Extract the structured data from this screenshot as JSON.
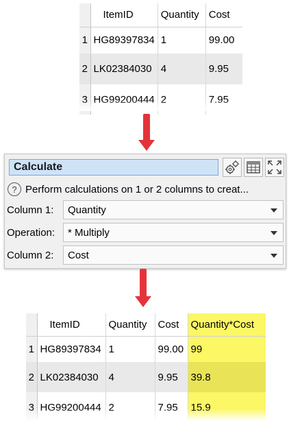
{
  "input_table": {
    "columns": [
      "ItemID",
      "Quantity",
      "Cost"
    ],
    "rows": [
      {
        "num": "1",
        "item": "HG89397834",
        "qty": "1",
        "cost": "99.00"
      },
      {
        "num": "2",
        "item": "LK02384030",
        "qty": "4",
        "cost": "9.95"
      },
      {
        "num": "3",
        "item": "HG99200444",
        "qty": "2",
        "cost": "7.95"
      }
    ]
  },
  "arrow_color": "#e4343b",
  "calculate_panel": {
    "title": "Calculate",
    "description": "Perform calculations on 1 or 2 columns to creat...",
    "help_icon": "question-icon",
    "tool_icons": [
      "gear-icon",
      "table-icon",
      "expand-icon"
    ],
    "fields": [
      {
        "label": "Column 1:",
        "value": "Quantity"
      },
      {
        "label": "Operation:",
        "value": "* Multiply"
      },
      {
        "label": "Column 2:",
        "value": "Cost"
      }
    ]
  },
  "output_table": {
    "columns": [
      "ItemID",
      "Quantity",
      "Cost",
      "Quantity*Cost"
    ],
    "highlight_color": "#fbf765",
    "rows": [
      {
        "num": "1",
        "item": "HG89397834",
        "qty": "1",
        "cost": "99.00",
        "result": "99"
      },
      {
        "num": "2",
        "item": "LK02384030",
        "qty": "4",
        "cost": "9.95",
        "result": "39.8"
      },
      {
        "num": "3",
        "item": "HG99200444",
        "qty": "2",
        "cost": "7.95",
        "result": "15.9"
      }
    ]
  }
}
